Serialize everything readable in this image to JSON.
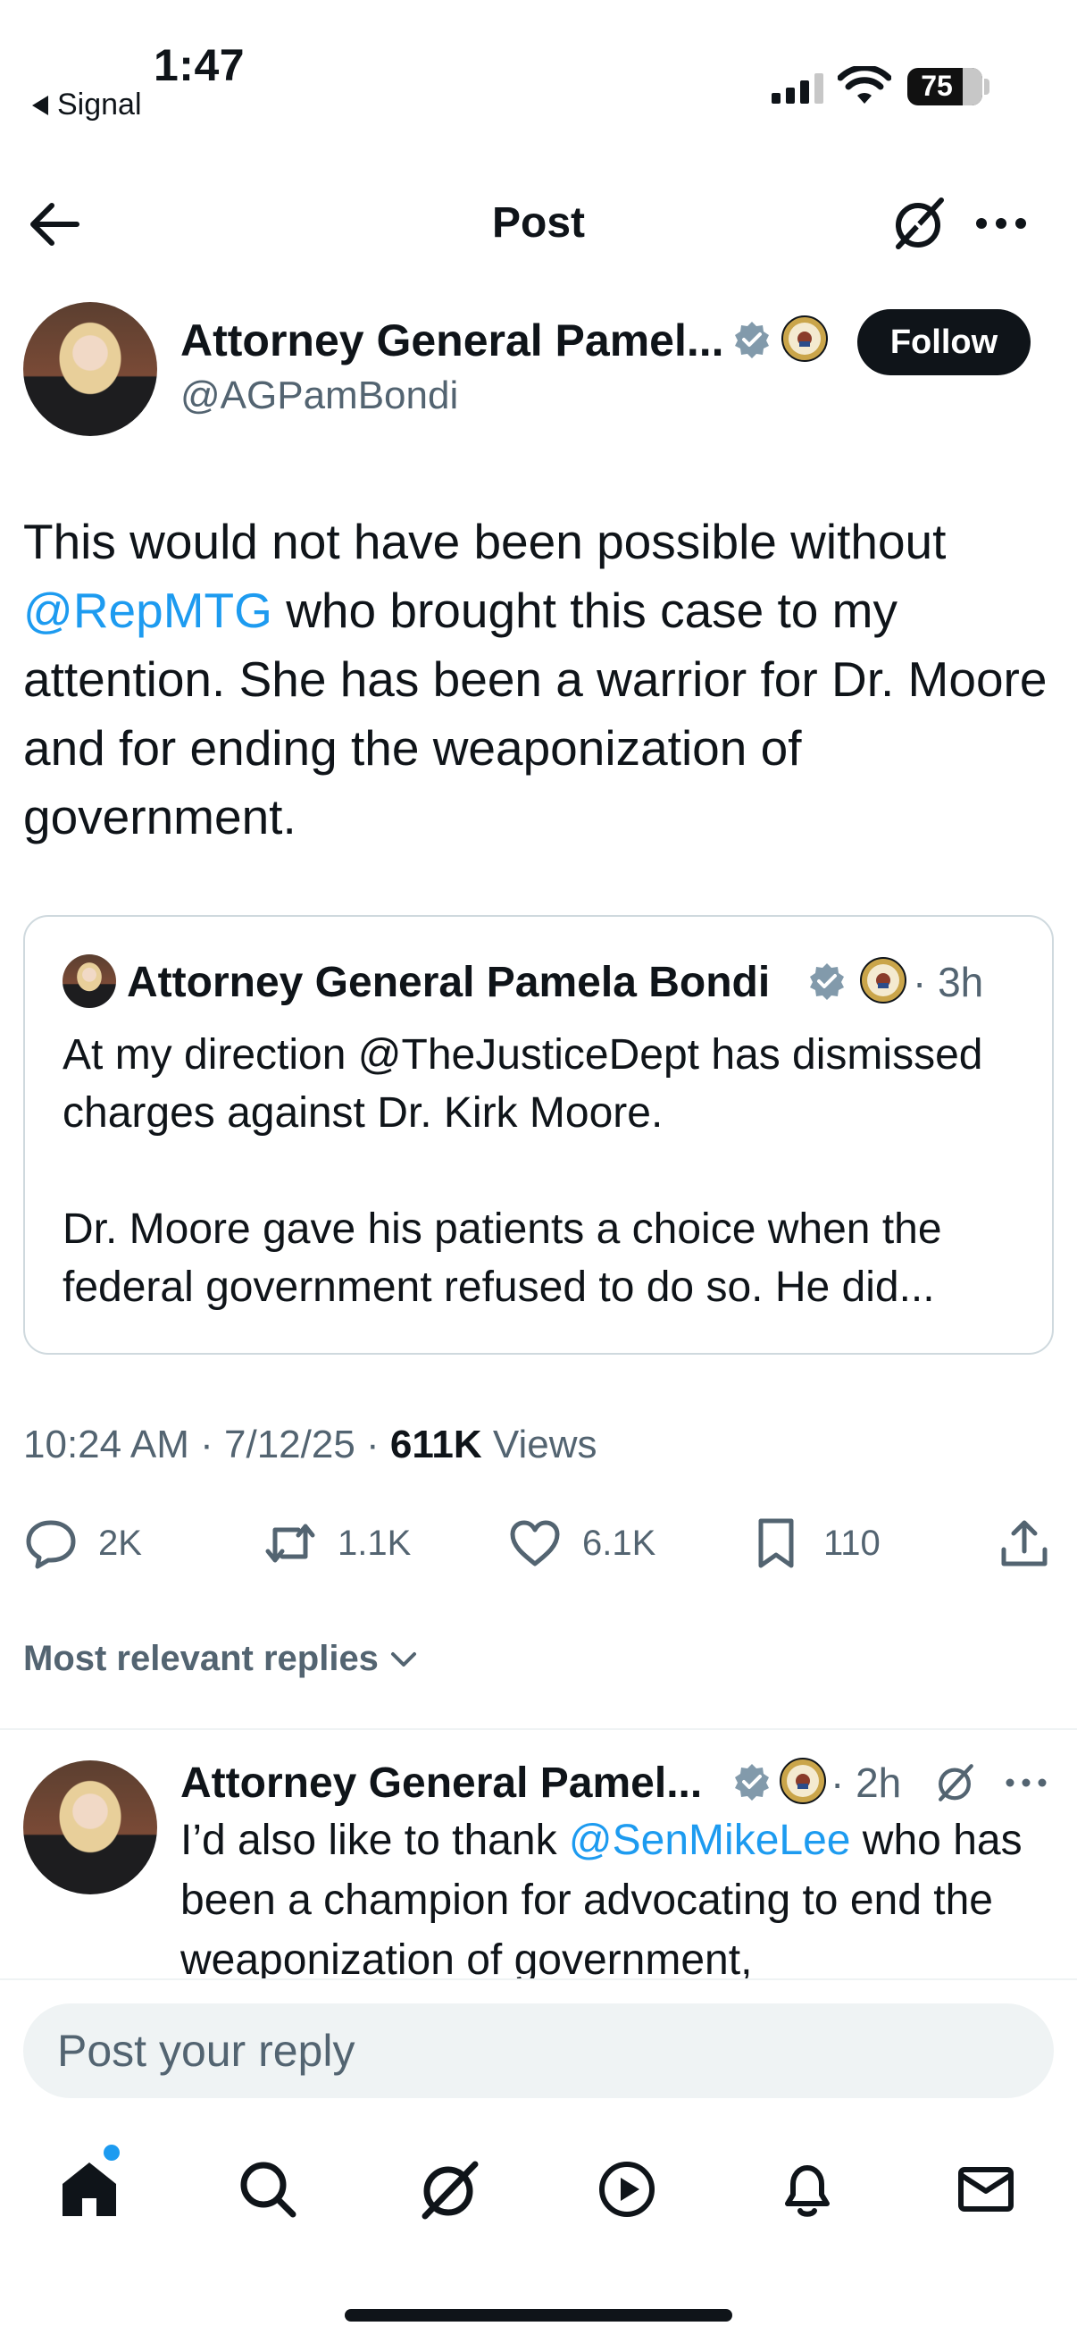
{
  "status_bar": {
    "time": "1:47",
    "back_app": "Signal",
    "battery": "75"
  },
  "header": {
    "title": "Post"
  },
  "post": {
    "author_name": "Attorney General Pamel...",
    "author_handle": "@AGPamBondi",
    "follow_label": "Follow",
    "text_part1": "This would not have been possible without ",
    "mention": "@RepMTG",
    "text_part2": " who brought this case to my attention. She has been a warrior for Dr. Moore and for ending the weaponization of government.",
    "timestamp": "10:24 AM · 7/12/25 · ",
    "views_count": "611K",
    "views_label": " Views"
  },
  "quote": {
    "author_name": "Attorney General Pamela Bondi",
    "time": "· 3h",
    "text_line1": "At my direction @TheJusticeDept has dismissed charges against Dr. Kirk Moore.",
    "text_line2": "Dr. Moore gave his patients a choice when the federal government refused to do so. He did..."
  },
  "actions": {
    "replies": "2K",
    "reposts": "1.1K",
    "likes": "6.1K",
    "bookmarks": "110"
  },
  "replies_filter": "Most relevant replies",
  "reply": {
    "author_name": "Attorney General Pamel...",
    "time": "· 2h",
    "text_part1": "I’d also like to thank ",
    "mention": "@SenMikeLee",
    "text_part2": " who has been a champion for advocating to end the weaponization of government,"
  },
  "composer": {
    "placeholder": "Post your reply"
  },
  "colors": {
    "accent": "#1d9bf0",
    "text": "#0f1419",
    "muted": "#536471",
    "verified": "#829aab"
  },
  "icons": [
    "back-arrow-icon",
    "grok-icon",
    "more-icon",
    "verified-badge-icon",
    "doj-seal-icon",
    "reply-icon",
    "repost-icon",
    "like-icon",
    "bookmark-icon",
    "share-icon",
    "chevron-down-icon",
    "home-icon",
    "search-icon",
    "video-icon",
    "bell-icon",
    "mail-icon"
  ]
}
